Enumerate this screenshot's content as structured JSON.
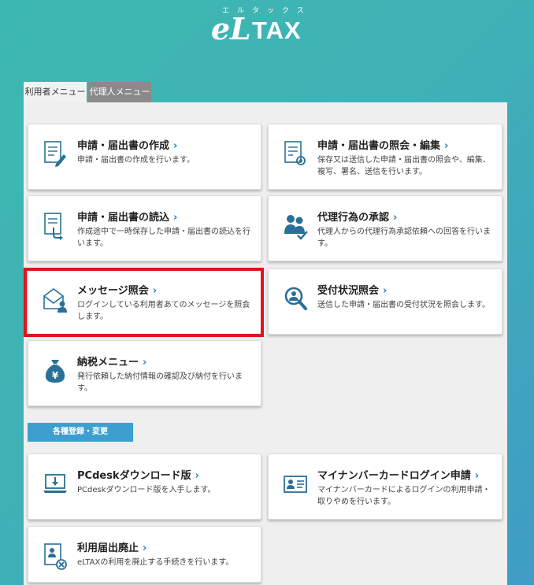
{
  "logo": {
    "kana": "エルタックス",
    "e": "e",
    "l": "L",
    "tax": "TAX"
  },
  "tabs": [
    {
      "label": "利用者メニュー",
      "active": true
    },
    {
      "label": "代理人メニュー",
      "active": false
    }
  ],
  "menu": [
    {
      "title": "申請・届出書の作成",
      "desc": "申請・届出書の作成を行います。",
      "icon": "document-pen-icon"
    },
    {
      "title": "申請・届出書の照会・編集",
      "desc": "保存又は送信した申請・届出書の照会や、編集、複写、署名、送信を行います。",
      "icon": "document-search-icon"
    },
    {
      "title": "申請・届出書の読込",
      "desc": "作成途中で一時保存した申請・届出書の読込を行います。",
      "icon": "document-load-icon"
    },
    {
      "title": "代理行為の承認",
      "desc": "代理人からの代理行為承認依頼への回答を行います。",
      "icon": "users-check-icon"
    },
    {
      "title": "メッセージ照会",
      "desc": "ログインしている利用者あてのメッセージを照会します。",
      "icon": "mail-user-icon"
    },
    {
      "title": "受付状況照会",
      "desc": "送信した申請・届出書の受付状況を照会します。",
      "icon": "magnifier-user-icon"
    },
    {
      "title": "納税メニュー",
      "desc": "発行依頼した納付情報の確認及び納付を行います。",
      "icon": "yen-bag-icon"
    }
  ],
  "section": {
    "label": "各種登録・変更"
  },
  "settings": [
    {
      "title": "PCdeskダウンロード版",
      "desc": "PCdeskダウンロード版を入手します。",
      "icon": "laptop-download-icon"
    },
    {
      "title": "マイナンバーカードログイン申請",
      "desc": "マイナンバーカードによるログインの利用申請・取りやめを行います。",
      "icon": "id-card-icon"
    },
    {
      "title": "利用届出廃止",
      "desc": "eLTAXの利用を廃止する手続きを行います。",
      "icon": "document-cancel-icon"
    }
  ],
  "chevron": "›",
  "colors": {
    "accent": "#1a7fc8",
    "icon": "#2a6f97",
    "highlight": "#e3131b"
  }
}
